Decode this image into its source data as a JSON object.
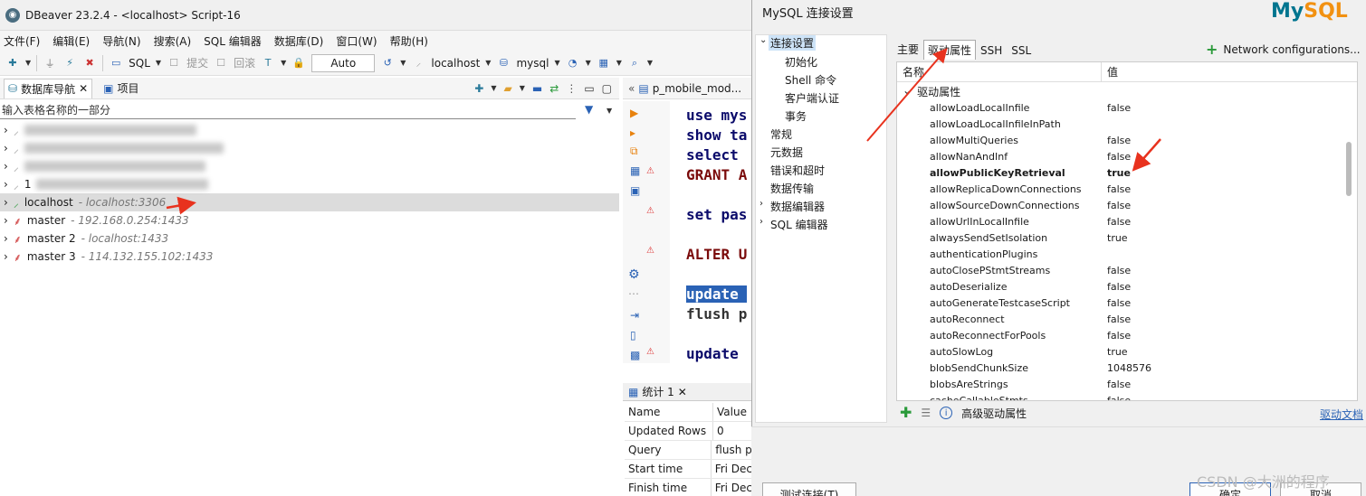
{
  "window": {
    "title": "DBeaver 23.2.4 - <localhost> Script-16",
    "app_icon": "dbeaver-icon"
  },
  "menu": [
    "文件(F)",
    "编辑(E)",
    "导航(N)",
    "搜索(A)",
    "SQL 编辑器",
    "数据库(D)",
    "窗口(W)",
    "帮助(H)"
  ],
  "toolbar": {
    "sql_label": "SQL",
    "commit_label": "提交",
    "rollback_label": "回滚",
    "tx_mode": "Auto",
    "datasource": "localhost",
    "schema": "mysql"
  },
  "navigator": {
    "tabs": [
      "数据库导航",
      "项目"
    ],
    "filter_placeholder": "输入表格名称的一部分",
    "connections": [
      {
        "name": "localhost",
        "host": "- localhost:3306"
      },
      {
        "name": "master",
        "host": "- 192.168.0.254:1433"
      },
      {
        "name": "master 2",
        "host": "- localhost:1433"
      },
      {
        "name": "master 3",
        "host": "- 114.132.155.102:1433"
      }
    ],
    "partial_row_label": "1"
  },
  "editor": {
    "tab_label": "p_mobile_mod...",
    "lines": [
      "use mys",
      "show ta",
      "select ",
      "GRANT A",
      "set pas",
      "ALTER U",
      "update ",
      "flush p",
      "update "
    ]
  },
  "stats": {
    "tab_label": "统计 1",
    "header": {
      "name": "Name",
      "value": "Value"
    },
    "rows": [
      {
        "name": "Updated Rows",
        "value": "0"
      },
      {
        "name": "Query",
        "value": "flush p"
      },
      {
        "name": "Start time",
        "value": "Fri Dec"
      },
      {
        "name": "Finish time",
        "value": "Fri Dec"
      }
    ]
  },
  "dialog": {
    "title": "MySQL 连接设置",
    "logo_my": "My",
    "logo_sql": "SQL",
    "nav": {
      "root": "连接设置",
      "children": [
        "初始化",
        "Shell 命令",
        "客户端认证",
        "事务"
      ],
      "others": [
        "常规",
        "元数据",
        "错误和超时",
        "数据传输",
        "数据编辑器",
        "SQL 编辑器"
      ]
    },
    "tabs": [
      "主要",
      "驱动属性",
      "SSH",
      "SSL"
    ],
    "network_config": "Network configurations...",
    "grid": {
      "col_name": "名称",
      "col_value": "值",
      "group": "驱动属性",
      "properties": [
        {
          "name": "allowLoadLocalInfile",
          "value": "false"
        },
        {
          "name": "allowLoadLocalInfileInPath",
          "value": ""
        },
        {
          "name": "allowMultiQueries",
          "value": "false"
        },
        {
          "name": "allowNanAndInf",
          "value": "false"
        },
        {
          "name": "allowPublicKeyRetrieval",
          "value": "true",
          "bold": true
        },
        {
          "name": "allowReplicaDownConnections",
          "value": "false"
        },
        {
          "name": "allowSourceDownConnections",
          "value": "false"
        },
        {
          "name": "allowUrlInLocalInfile",
          "value": "false"
        },
        {
          "name": "alwaysSendSetIsolation",
          "value": "true"
        },
        {
          "name": "authenticationPlugins",
          "value": ""
        },
        {
          "name": "autoClosePStmtStreams",
          "value": "false"
        },
        {
          "name": "autoDeserialize",
          "value": "false"
        },
        {
          "name": "autoGenerateTestcaseScript",
          "value": "false"
        },
        {
          "name": "autoReconnect",
          "value": "false"
        },
        {
          "name": "autoReconnectForPools",
          "value": "false"
        },
        {
          "name": "autoSlowLog",
          "value": "true"
        },
        {
          "name": "blobSendChunkSize",
          "value": "1048576"
        },
        {
          "name": "blobsAreStrings",
          "value": "false"
        },
        {
          "name": "cacheCallableStmts",
          "value": "false"
        }
      ]
    },
    "footer_label": "高级驱动属性",
    "driver_doc": "驱动文档",
    "buttons": {
      "test": "测试连接(T)",
      "ok": "确定",
      "cancel": "取消"
    }
  },
  "watermark": "CSDN @大洲的程序",
  "colors": {
    "accent": "#2a62b5",
    "annotation_arrow": "#e8321e",
    "selection": "#dcdcdc"
  }
}
